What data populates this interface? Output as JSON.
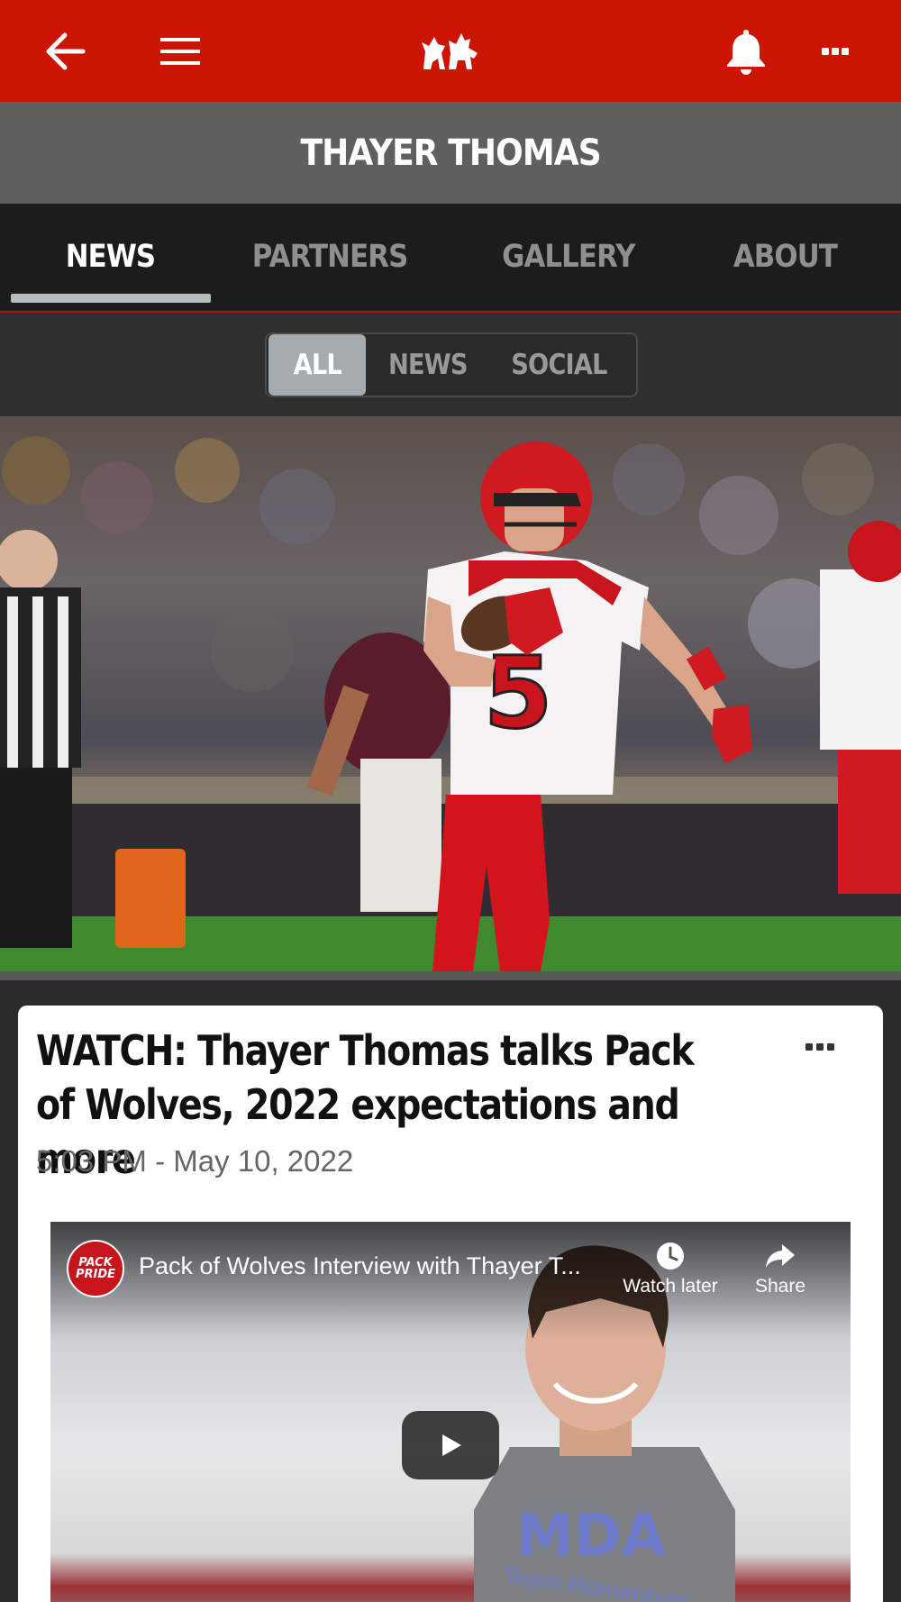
{
  "header": {
    "back_icon": "arrow-left-icon",
    "menu_icon": "hamburger-icon",
    "logo_icon": "wolf-pack-logo",
    "notifications_icon": "bell-icon",
    "more_icon": "ellipsis-icon",
    "bar_color": "#cc1500"
  },
  "page_title": "THAYER THOMAS",
  "tabs": [
    {
      "label": "NEWS",
      "active": true
    },
    {
      "label": "PARTNERS",
      "active": false
    },
    {
      "label": "GALLERY",
      "active": false
    },
    {
      "label": "ABOUT",
      "active": false
    }
  ],
  "filter": {
    "options": [
      "ALL",
      "NEWS",
      "SOCIAL"
    ],
    "selected": "ALL"
  },
  "hero": {
    "jersey_number": "5"
  },
  "post": {
    "title": "WATCH: Thayer Thomas talks Pack of Wolves, 2022 expectations and more",
    "timestamp": "5:03 PM - May 10, 2022",
    "more_icon": "ellipsis-icon",
    "video": {
      "channel_logo_text": "PACK PRIDE",
      "title": "Pack of Wolves Interview with Thayer T...",
      "watch_later_label": "Watch later",
      "share_label": "Share",
      "play_icon": "play-icon",
      "shirt_text": "MDA",
      "shirt_subtext": "Team Momentum"
    }
  }
}
